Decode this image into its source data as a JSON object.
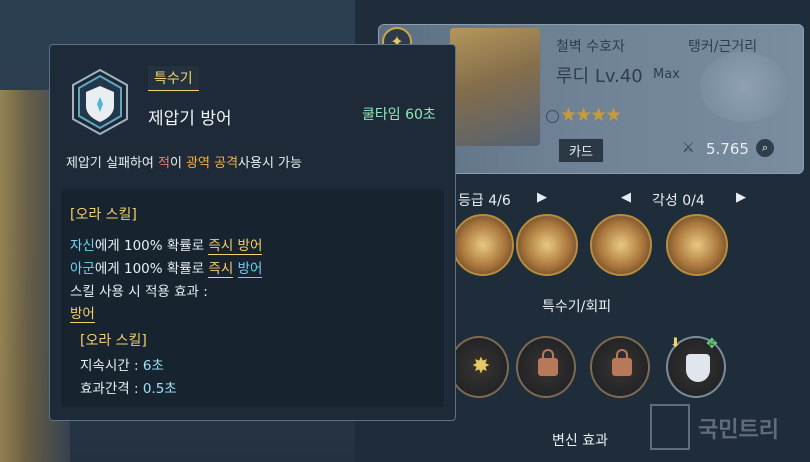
{
  "card": {
    "class": "철벽 수호자",
    "role": "탱커/근거리",
    "name": "루디 Lv.40",
    "max": "Max",
    "stars": "★★★★",
    "badge": "카드",
    "power": "5.765"
  },
  "nav": {
    "grade": "등급 4/6",
    "awaken": "각성 0/4",
    "prev": "◀",
    "next": "▶"
  },
  "sections": {
    "special": "특수기/회피",
    "transform": "변신 효과"
  },
  "watermark": "국민트리",
  "tooltip": {
    "category": "특수기",
    "name": "제압기 방어",
    "cooldown": "쿨타임 60초",
    "desc_1": "제압기 실패하여 ",
    "desc_enemy": "적",
    "desc_2": "이 ",
    "desc_area": "광역 공격",
    "desc_3": "사용시 가능",
    "aura_title": "[오라 스킬]",
    "line1_who": "자신",
    "line1_mid": "에게 100% 확률로 ",
    "line1_act": "즉시 방어",
    "line2_who": "아군",
    "line2_mid": "에게 100% 확률로 ",
    "line2_act1": "즉시",
    "line2_act2": "방어",
    "line3": "스킬 사용 시 적용 효과 :",
    "line4": "방어",
    "sub_title": "[오라 스킬]",
    "duration_label": "지속시간 : ",
    "duration_value": "6초",
    "interval_label": "효과간격 : ",
    "interval_value": "0.5초"
  },
  "colors": {
    "accent_yellow": "#f2d26c",
    "cooldown_green": "#8fe6b9",
    "highlight_cyan": "#6fd3f0",
    "enemy_red": "#f07a7a",
    "area_orange": "#f0b24a"
  }
}
